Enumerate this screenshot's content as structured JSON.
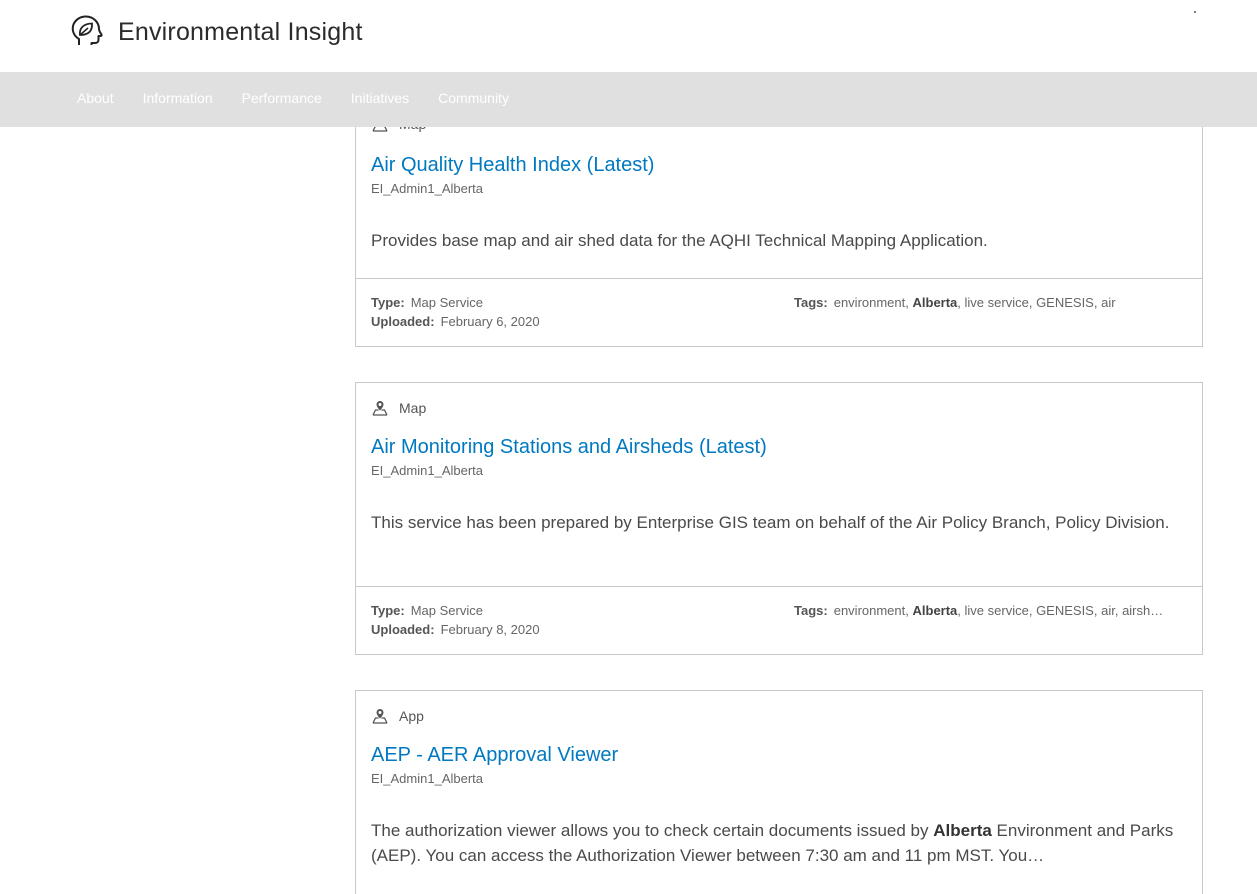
{
  "header": {
    "title": "Environmental Insight",
    "logo_icon": "head-with-leaf-icon"
  },
  "nav": {
    "items": [
      "About",
      "Information",
      "Performance",
      "Initiatives",
      "Community"
    ]
  },
  "cards": [
    {
      "type": "Map",
      "title": "Air Quality Health Index (Latest)",
      "owner": "EI_Admin1_Alberta",
      "description": "Provides base map and air shed data for the AQHI Technical Mapping Application.",
      "type_label": "Type:",
      "type_value": "Map Service",
      "uploaded_label": "Uploaded:",
      "uploaded_value": "February 6, 2020",
      "tags_label": "Tags:",
      "tags": [
        "environment",
        "Alberta",
        "live service",
        "GENESIS",
        "air"
      ]
    },
    {
      "type": "Map",
      "title": "Air Monitoring Stations and Airsheds (Latest)",
      "owner": "EI_Admin1_Alberta",
      "description": "This service has been prepared by Enterprise GIS team on behalf of the Air Policy Branch, Policy Division.",
      "type_label": "Type:",
      "type_value": "Map Service",
      "uploaded_label": "Uploaded:",
      "uploaded_value": "February 8, 2020",
      "tags_label": "Tags:",
      "tags": [
        "environment",
        "Alberta",
        "live service",
        "GENESIS",
        "air",
        "airsh…"
      ]
    },
    {
      "type": "App",
      "title": "AEP - AER Approval Viewer",
      "owner": "EI_Admin1_Alberta",
      "description_pre": "The authorization viewer allows you to check certain documents issued by ",
      "description_bold": "Alberta",
      "description_post": " Environment and Parks (AEP). You can access the Authorization Viewer between 7:30 am and 11 pm MST. You…"
    }
  ],
  "colors": {
    "link": "#0079c1",
    "nav_bg": "#e0e0e0",
    "border": "#c9c9c9"
  }
}
